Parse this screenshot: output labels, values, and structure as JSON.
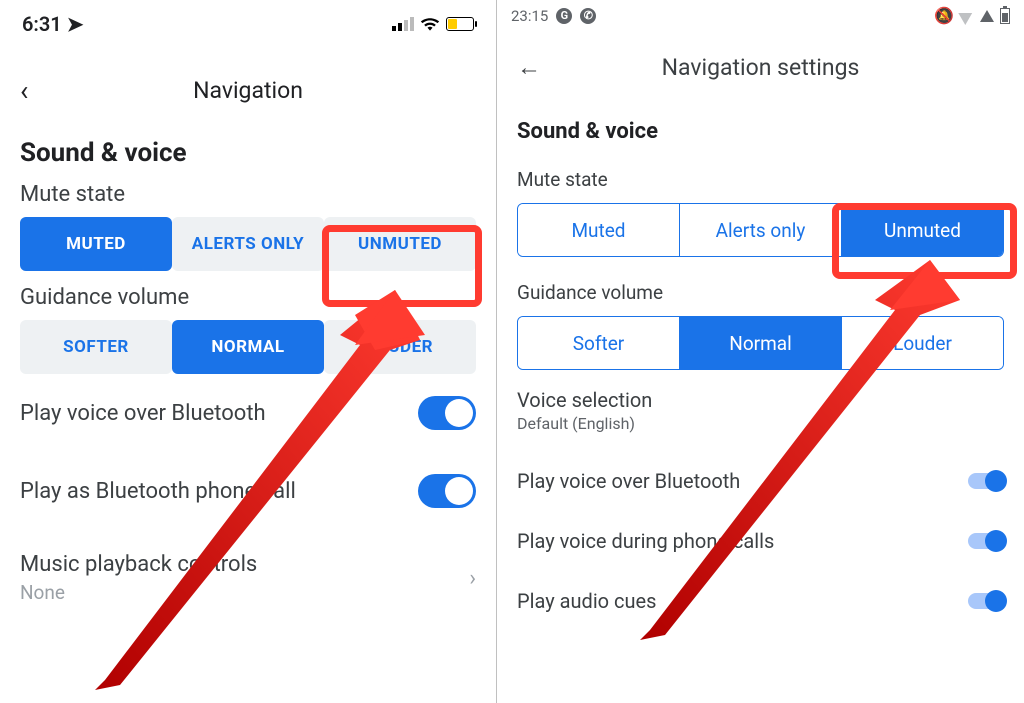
{
  "left": {
    "status_time": "6:31",
    "nav_title": "Navigation",
    "section_title": "Sound & voice",
    "mute_label": "Mute state",
    "mute_options": {
      "a": "MUTED",
      "b": "ALERTS ONLY",
      "c": "UNMUTED"
    },
    "guidance_label": "Guidance volume",
    "guidance_options": {
      "a": "SOFTER",
      "b": "NORMAL",
      "c": "LOUDER"
    },
    "row_bt": "Play voice over Bluetooth",
    "row_call": "Play as Bluetooth phone call",
    "row_music": "Music playback controls",
    "row_music_sub": "None"
  },
  "right": {
    "status_time": "23:15",
    "nav_title": "Navigation settings",
    "section_title": "Sound & voice",
    "mute_label": "Mute state",
    "mute_options": {
      "a": "Muted",
      "b": "Alerts only",
      "c": "Unmuted"
    },
    "guidance_label": "Guidance volume",
    "guidance_options": {
      "a": "Softer",
      "b": "Normal",
      "c": "Louder"
    },
    "voice_sel": "Voice selection",
    "voice_sel_sub": "Default (English)",
    "row_bt": "Play voice over Bluetooth",
    "row_calls": "Play voice during phone calls",
    "row_cues": "Play audio cues"
  }
}
